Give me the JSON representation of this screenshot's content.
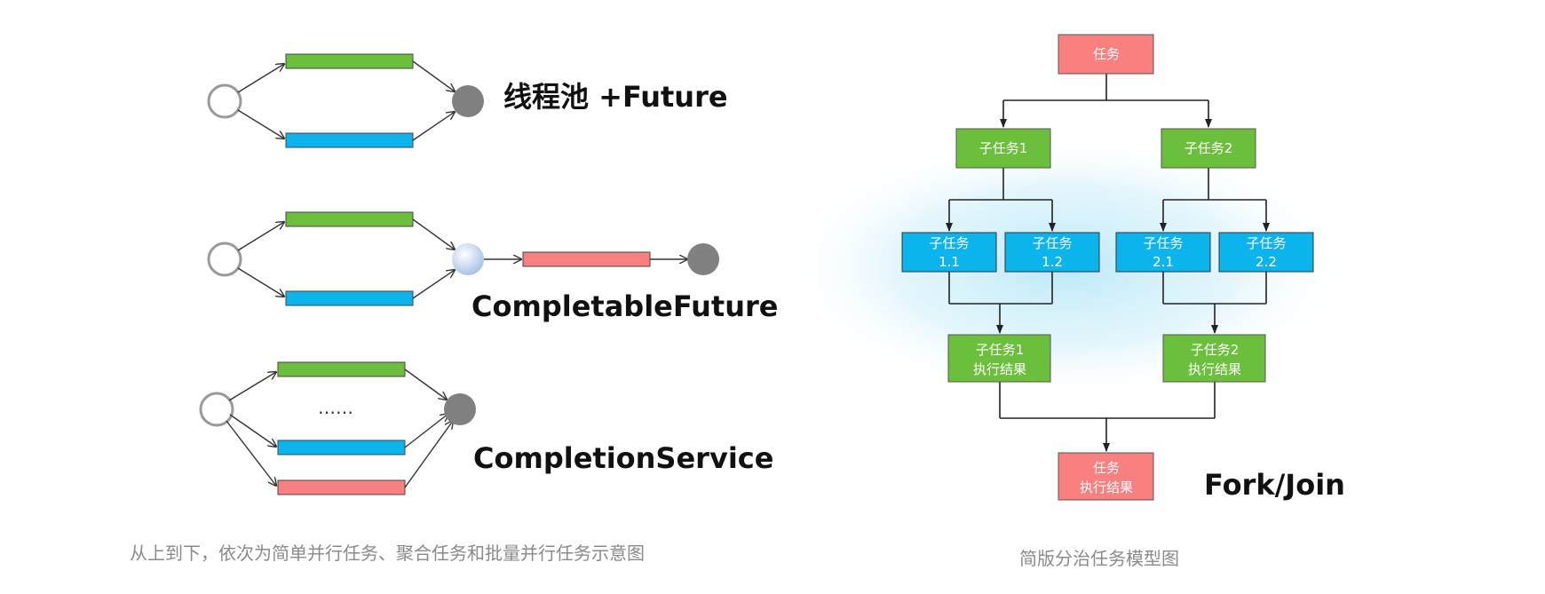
{
  "colors": {
    "green": "#6cbf3c",
    "blue": "#0cb4ee",
    "red": "#f98080",
    "gray_node": "#808080",
    "glow": "#cdeefa"
  },
  "left_panel": {
    "labels": {
      "threadpool": "线程池 +Future",
      "completable": "CompletableFuture",
      "completion_service": "CompletionService"
    },
    "ellipsis": "……",
    "caption": "从上到下，依次为简单并行任务、聚合任务和批量并行任务示意图"
  },
  "right_panel": {
    "root": "任务",
    "sub1": "子任务1",
    "sub2": "子任务2",
    "sub11": [
      "子任务",
      "1.1"
    ],
    "sub12": [
      "子任务",
      "1.2"
    ],
    "sub21": [
      "子任务",
      "2.1"
    ],
    "sub22": [
      "子任务",
      "2.2"
    ],
    "result1": [
      "子任务1",
      "执行结果"
    ],
    "result2": [
      "子任务2",
      "执行结果"
    ],
    "final": [
      "任务",
      "执行结果"
    ],
    "label": "Fork/Join",
    "caption": "简版分治任务模型图"
  }
}
